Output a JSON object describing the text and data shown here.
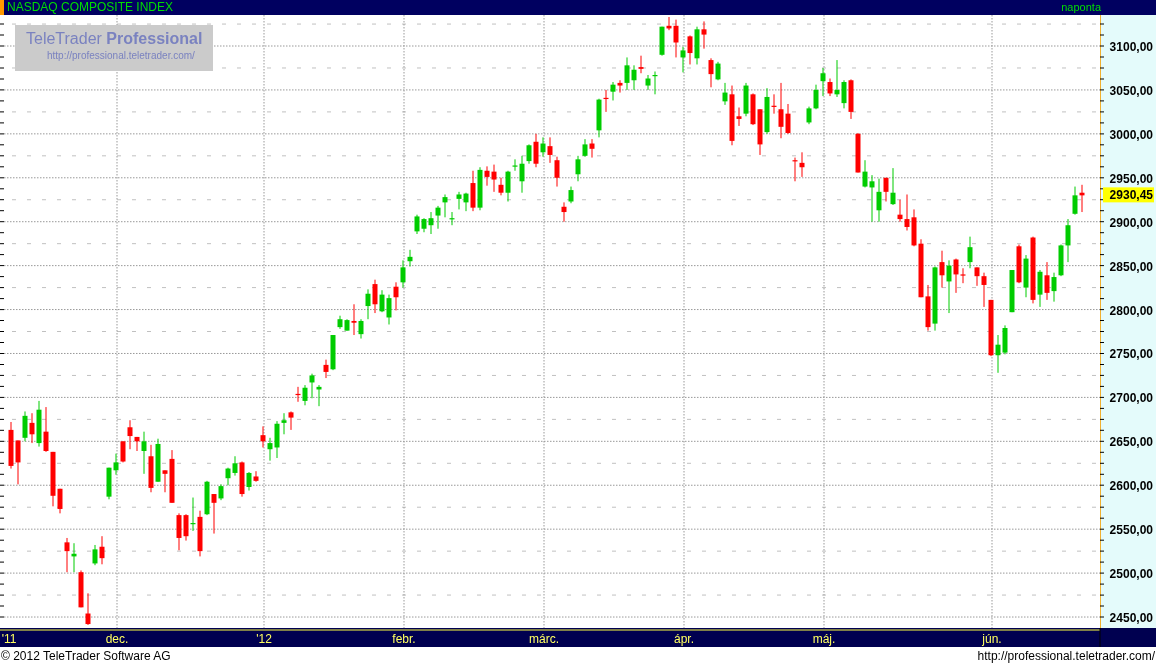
{
  "header": {
    "title": "NASDAQ COMPOSITE INDEX",
    "interval": "naponta"
  },
  "logo": {
    "name": "TeleTrader",
    "name_bold": "Professional",
    "url": "http://professional.teletrader.com/"
  },
  "chart": {
    "last_price": "2930,45",
    "chart_data": {
      "type": "candlestick",
      "grid": true,
      "ylim": [
        2437.5,
        3135.3
      ],
      "categories": [
        "'11",
        null,
        null,
        null,
        null,
        null,
        null,
        null,
        null,
        null,
        null,
        null,
        null,
        null,
        null,
        "dec.",
        null,
        null,
        null,
        null,
        null,
        null,
        null,
        null,
        null,
        null,
        null,
        null,
        null,
        null,
        null,
        null,
        null,
        null,
        null,
        null,
        "'12",
        null,
        null,
        null,
        null,
        null,
        null,
        null,
        null,
        null,
        null,
        null,
        null,
        null,
        null,
        null,
        null,
        null,
        null,
        null,
        "febr.",
        null,
        null,
        null,
        null,
        null,
        null,
        null,
        null,
        null,
        null,
        null,
        null,
        null,
        null,
        null,
        null,
        null,
        null,
        null,
        "márc.",
        null,
        null,
        null,
        null,
        null,
        null,
        null,
        null,
        null,
        null,
        null,
        null,
        null,
        null,
        null,
        null,
        null,
        null,
        null,
        "ápr.",
        null,
        null,
        null,
        null,
        null,
        null,
        null,
        null,
        null,
        null,
        null,
        null,
        null,
        null,
        null,
        null,
        null,
        null,
        null,
        "máj.",
        null,
        null,
        null,
        null,
        null,
        null,
        null,
        null,
        null,
        null,
        null,
        null,
        null,
        null,
        null,
        null,
        null,
        null,
        null,
        null,
        null,
        null,
        null,
        "jún.",
        null,
        null,
        null,
        null,
        null,
        null,
        null,
        null,
        null,
        null,
        null,
        null,
        null
      ],
      "yticks": [
        {
          "value": 2450,
          "label": "2450,00"
        },
        {
          "value": 2500,
          "label": "2500,00"
        },
        {
          "value": 2550,
          "label": "2550,00"
        },
        {
          "value": 2600,
          "label": "2600,00"
        },
        {
          "value": 2650,
          "label": "2650,00"
        },
        {
          "value": 2700,
          "label": "2700,00"
        },
        {
          "value": 2750,
          "label": "2750,00"
        },
        {
          "value": 2800,
          "label": "2800,00"
        },
        {
          "value": 2850,
          "label": "2850,00"
        },
        {
          "value": 2900,
          "label": "2900,00"
        },
        {
          "value": 2950,
          "label": "2950,00"
        },
        {
          "value": 3000,
          "label": "3000,00"
        },
        {
          "value": 3050,
          "label": "3050,00"
        },
        {
          "value": 3100,
          "label": "3100,00"
        }
      ],
      "ohlc": [
        [
          2663,
          2672,
          2619,
          2622
        ],
        [
          2651,
          2651,
          2601,
          2626
        ],
        [
          2654,
          2684,
          2650,
          2679
        ],
        [
          2671,
          2682,
          2648,
          2658
        ],
        [
          2648,
          2696,
          2644,
          2686
        ],
        [
          2661,
          2689,
          2638,
          2639
        ],
        [
          2638,
          2638,
          2576,
          2588
        ],
        [
          2596,
          2596,
          2568,
          2573
        ],
        [
          2535,
          2540,
          2501,
          2525
        ],
        [
          2519,
          2534,
          2501,
          2522
        ],
        [
          2501,
          2503,
          2461,
          2461
        ],
        [
          2454,
          2477,
          2441,
          2442
        ],
        [
          2511,
          2532,
          2509,
          2527
        ],
        [
          2530,
          2542,
          2510,
          2517
        ],
        [
          2587,
          2620,
          2584,
          2620
        ],
        [
          2617,
          2636,
          2612,
          2626
        ],
        [
          2650,
          2650,
          2626,
          2627
        ],
        [
          2666,
          2674,
          2641,
          2656
        ],
        [
          2655,
          2655,
          2639,
          2650
        ],
        [
          2639,
          2661,
          2613,
          2650
        ],
        [
          2633,
          2646,
          2592,
          2597
        ],
        [
          2604,
          2653,
          2604,
          2647
        ],
        [
          2617,
          2617,
          2592,
          2613
        ],
        [
          2630,
          2640,
          2580,
          2580
        ],
        [
          2566,
          2568,
          2526,
          2540
        ],
        [
          2566,
          2567,
          2537,
          2542
        ],
        [
          2556,
          2586,
          2548,
          2557
        ],
        [
          2564,
          2571,
          2519,
          2525
        ],
        [
          2567,
          2605,
          2566,
          2604
        ],
        [
          2590,
          2590,
          2545,
          2580
        ],
        [
          2585,
          2601,
          2583,
          2599
        ],
        [
          2608,
          2620,
          2600,
          2619
        ],
        [
          2614,
          2633,
          2611,
          2625
        ],
        [
          2626,
          2627,
          2587,
          2590
        ],
        [
          2598,
          2615,
          2594,
          2614
        ],
        [
          2610,
          2616,
          2604,
          2605
        ],
        [
          2657,
          2667,
          2643,
          2650
        ],
        [
          2641,
          2654,
          2628,
          2648
        ],
        [
          2643,
          2673,
          2631,
          2670
        ],
        [
          2671,
          2682,
          2658,
          2674
        ],
        [
          2683,
          2684,
          2663,
          2677
        ],
        [
          2704,
          2712,
          2695,
          2703
        ],
        [
          2696,
          2714,
          2691,
          2711
        ],
        [
          2717,
          2727,
          2699,
          2725
        ],
        [
          2709,
          2714,
          2690,
          2712
        ],
        [
          2737,
          2743,
          2722,
          2729
        ],
        [
          2732,
          2771,
          2731,
          2771
        ],
        [
          2780,
          2793,
          2778,
          2789
        ],
        [
          2776,
          2789,
          2776,
          2788
        ],
        [
          2787,
          2806,
          2771,
          2785
        ],
        [
          2772,
          2789,
          2767,
          2787
        ],
        [
          2804,
          2823,
          2789,
          2818
        ],
        [
          2829,
          2834,
          2796,
          2806
        ],
        [
          2798,
          2822,
          2797,
          2817
        ],
        [
          2791,
          2817,
          2783,
          2813
        ],
        [
          2826,
          2831,
          2799,
          2814
        ],
        [
          2831,
          2856,
          2825,
          2848
        ],
        [
          2855,
          2868,
          2849,
          2860
        ],
        [
          2889,
          2908,
          2886,
          2906
        ],
        [
          2892,
          2904,
          2888,
          2903
        ],
        [
          2896,
          2911,
          2886,
          2904
        ],
        [
          2907,
          2918,
          2892,
          2916
        ],
        [
          2922,
          2931,
          2905,
          2928
        ],
        [
          2903,
          2911,
          2896,
          2904
        ],
        [
          2926,
          2934,
          2914,
          2931
        ],
        [
          2922,
          2933,
          2912,
          2932
        ],
        [
          2944,
          2958,
          2912,
          2916
        ],
        [
          2916,
          2962,
          2913,
          2959
        ],
        [
          2958,
          2963,
          2941,
          2951
        ],
        [
          2957,
          2965,
          2934,
          2948
        ],
        [
          2942,
          2950,
          2930,
          2933
        ],
        [
          2933,
          2958,
          2923,
          2957
        ],
        [
          2964,
          2971,
          2958,
          2964
        ],
        [
          2946,
          2975,
          2933,
          2966
        ],
        [
          2969,
          2988,
          2966,
          2987
        ],
        [
          2991,
          3000,
          2962,
          2966
        ],
        [
          2979,
          2996,
          2974,
          2989
        ],
        [
          2986,
          2996,
          2967,
          2976
        ],
        [
          2970,
          2974,
          2940,
          2950
        ],
        [
          2917,
          2922,
          2900,
          2911
        ],
        [
          2923,
          2940,
          2921,
          2936
        ],
        [
          2954,
          2975,
          2946,
          2971
        ],
        [
          2975,
          2994,
          2974,
          2988
        ],
        [
          2989,
          2994,
          2973,
          2983
        ],
        [
          3004,
          3040,
          2996,
          3039
        ],
        [
          3041,
          3050,
          3025,
          3040
        ],
        [
          3048,
          3059,
          3038,
          3056
        ],
        [
          3058,
          3061,
          3047,
          3055
        ],
        [
          3058,
          3087,
          3050,
          3078
        ],
        [
          3061,
          3078,
          3050,
          3073
        ],
        [
          3076,
          3089,
          3069,
          3074
        ],
        [
          3055,
          3067,
          3050,
          3063
        ],
        [
          3067,
          3071,
          3045,
          3067
        ],
        [
          3090,
          3122,
          3089,
          3122
        ],
        [
          3123,
          3133,
          3118,
          3120
        ],
        [
          3123,
          3130,
          3087,
          3104
        ],
        [
          3087,
          3099,
          3070,
          3095
        ],
        [
          3111,
          3112,
          3079,
          3092
        ],
        [
          3086,
          3122,
          3079,
          3119
        ],
        [
          3119,
          3128,
          3097,
          3113
        ],
        [
          3084,
          3086,
          3053,
          3068
        ],
        [
          3062,
          3082,
          3061,
          3080
        ],
        [
          3037,
          3058,
          3033,
          3047
        ],
        [
          3045,
          3055,
          2987,
          2992
        ],
        [
          3020,
          3030,
          3009,
          3017
        ],
        [
          3023,
          3058,
          3020,
          3055
        ],
        [
          3045,
          3046,
          3010,
          3011
        ],
        [
          3028,
          3028,
          2976,
          2988
        ],
        [
          3002,
          3052,
          3000,
          3042
        ],
        [
          3032,
          3045,
          3023,
          3031
        ],
        [
          3028,
          3058,
          2995,
          3008
        ],
        [
          3023,
          3034,
          3000,
          3001
        ],
        [
          2970,
          2973,
          2946,
          2970
        ],
        [
          2967,
          2979,
          2951,
          2962
        ],
        [
          3013,
          3031,
          3011,
          3029
        ],
        [
          3029,
          3056,
          3028,
          3050
        ],
        [
          3060,
          3075,
          3043,
          3069
        ],
        [
          3059,
          3063,
          3043,
          3046
        ],
        [
          3045,
          3084,
          3042,
          3050
        ],
        [
          3035,
          3061,
          3029,
          3059
        ],
        [
          3061,
          3062,
          3017,
          3025
        ],
        [
          3000,
          3001,
          2956,
          2956
        ],
        [
          2940,
          2970,
          2939,
          2957
        ],
        [
          2939,
          2953,
          2900,
          2946
        ],
        [
          2913,
          2949,
          2900,
          2934
        ],
        [
          2950,
          2950,
          2923,
          2934
        ],
        [
          2920,
          2961,
          2919,
          2933
        ],
        [
          2908,
          2925,
          2900,
          2903
        ],
        [
          2903,
          2931,
          2890,
          2894
        ],
        [
          2905,
          2914,
          2872,
          2873
        ],
        [
          2875,
          2880,
          2814,
          2814
        ],
        [
          2815,
          2828,
          2776,
          2780
        ],
        [
          2784,
          2849,
          2776,
          2848
        ],
        [
          2854,
          2867,
          2825,
          2839
        ],
        [
          2832,
          2856,
          2796,
          2850
        ],
        [
          2857,
          2858,
          2819,
          2840
        ],
        [
          2840,
          2847,
          2830,
          2839
        ],
        [
          2854,
          2883,
          2847,
          2871
        ],
        [
          2848,
          2848,
          2827,
          2838
        ],
        [
          2838,
          2842,
          2803,
          2828
        ],
        [
          2811,
          2811,
          2747,
          2748
        ],
        [
          2748,
          2771,
          2728,
          2760
        ],
        [
          2751,
          2782,
          2749,
          2779
        ],
        [
          2797,
          2845,
          2797,
          2845
        ],
        [
          2872,
          2874,
          2830,
          2831
        ],
        [
          2825,
          2862,
          2814,
          2858
        ],
        [
          2882,
          2883,
          2807,
          2811
        ],
        [
          2817,
          2845,
          2803,
          2843
        ],
        [
          2839,
          2854,
          2811,
          2819
        ],
        [
          2821,
          2842,
          2809,
          2837
        ],
        [
          2839,
          2874,
          2838,
          2873
        ],
        [
          2873,
          2903,
          2854,
          2896
        ],
        [
          2909,
          2940,
          2908,
          2930
        ],
        [
          2933,
          2942,
          2911,
          2930
        ]
      ]
    }
  },
  "footer": {
    "copyright": "© 2012 TeleTrader Software AG",
    "url": "http://professional.teletrader.com/"
  }
}
